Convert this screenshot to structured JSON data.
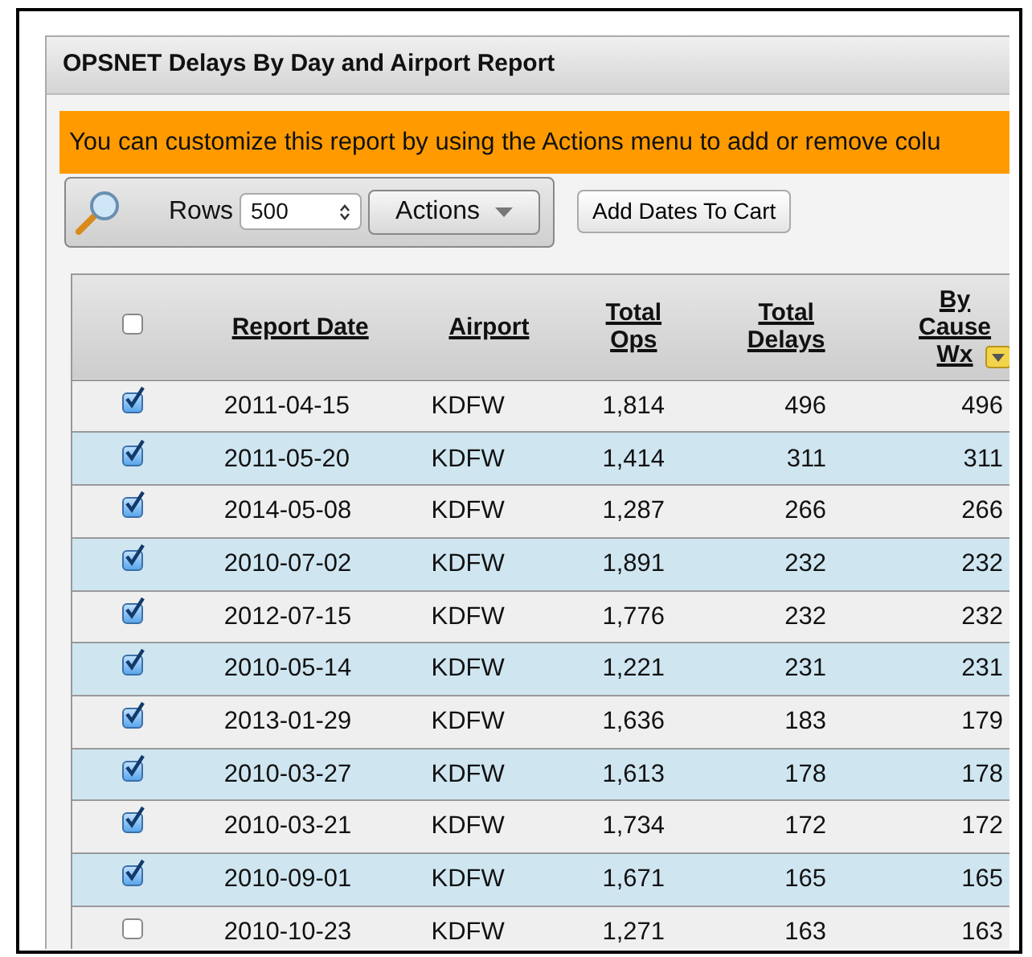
{
  "panel": {
    "title": "OPSNET Delays By Day and Airport Report"
  },
  "notice": "You can customize this report by using the Actions menu to add or remove colu",
  "toolbar": {
    "rows_label": "Rows",
    "rows_value": "500",
    "actions_button": "Actions",
    "cart_button": "Add Dates To Cart"
  },
  "table": {
    "select_all": {
      "checked": false
    },
    "columns": [
      {
        "label": "Report Date"
      },
      {
        "label": "Airport"
      },
      {
        "label": "Total Ops"
      },
      {
        "label": "Total Delays"
      },
      {
        "label": "By Cause Wx",
        "sorted": true
      }
    ],
    "rows": [
      {
        "checked": true,
        "cells": [
          "2011-04-15",
          "KDFW",
          "1,814",
          "496",
          "496"
        ]
      },
      {
        "checked": true,
        "cells": [
          "2011-05-20",
          "KDFW",
          "1,414",
          "311",
          "311"
        ]
      },
      {
        "checked": true,
        "cells": [
          "2014-05-08",
          "KDFW",
          "1,287",
          "266",
          "266"
        ]
      },
      {
        "checked": true,
        "cells": [
          "2010-07-02",
          "KDFW",
          "1,891",
          "232",
          "232"
        ]
      },
      {
        "checked": true,
        "cells": [
          "2012-07-15",
          "KDFW",
          "1,776",
          "232",
          "232"
        ]
      },
      {
        "checked": true,
        "cells": [
          "2010-05-14",
          "KDFW",
          "1,221",
          "231",
          "231"
        ]
      },
      {
        "checked": true,
        "cells": [
          "2013-01-29",
          "KDFW",
          "1,636",
          "183",
          "179"
        ]
      },
      {
        "checked": true,
        "cells": [
          "2010-03-27",
          "KDFW",
          "1,613",
          "178",
          "178"
        ]
      },
      {
        "checked": true,
        "cells": [
          "2010-03-21",
          "KDFW",
          "1,734",
          "172",
          "172"
        ]
      },
      {
        "checked": true,
        "cells": [
          "2010-09-01",
          "KDFW",
          "1,671",
          "165",
          "165"
        ]
      },
      {
        "checked": false,
        "cells": [
          "2010-10-23",
          "KDFW",
          "1,271",
          "163",
          "163"
        ]
      }
    ]
  }
}
